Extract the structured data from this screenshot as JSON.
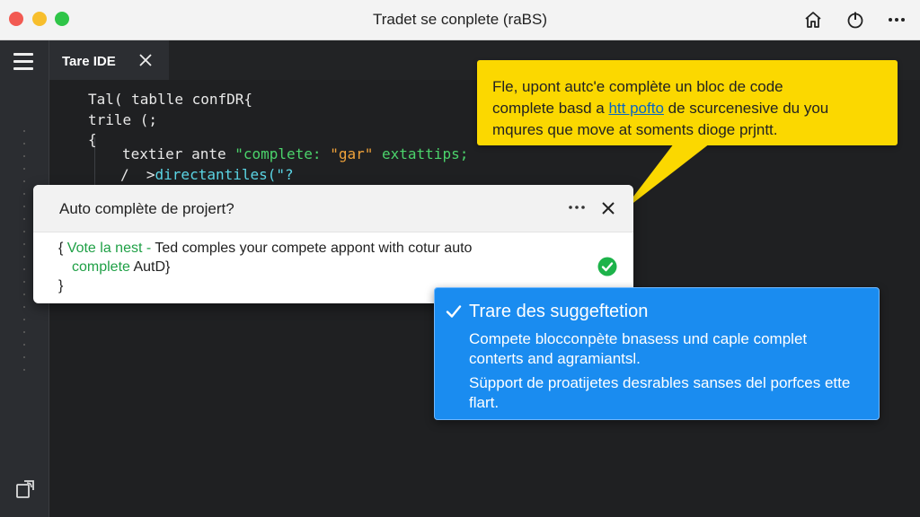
{
  "window": {
    "title": "Tradet se conplete (raBS)"
  },
  "titlebar_icons": [
    "home-icon",
    "power-icon",
    "more-icon"
  ],
  "tab": {
    "label": "Tare IDE"
  },
  "code": {
    "line1": "Tal( tablle confDR{",
    "line2": "trile (;",
    "line3": "{",
    "line4_a": "textier ante ",
    "line4_b": "\"complete: ",
    "line4_c": "\"gar\"",
    "line4_d": " extattips;",
    "line5_a": "/  >",
    "line5_b": "directantiles(\"?"
  },
  "callout": {
    "line1": "Fle, upont  autc'e complète un bloc de code",
    "line2_a": "complete basd a ",
    "line2_link": "htt pofto",
    "line2_b": " de scurcenesive du you",
    "line3": "mqures que move at soments dioge prjntt."
  },
  "dialog": {
    "title": "Auto complète de projert?",
    "line1_a": "{ ",
    "line1_b": "Vote la nest - ",
    "line1_c": "Ted comples your compete appont with cotur auto",
    "line2_a": "complete ",
    "line2_b": "AutD}",
    "line3": "}"
  },
  "suggestion": {
    "title": "Trare des suggeftetion",
    "p1": "Compete blocconpète bnasess und caple complet conterts and agramiantsl.",
    "p2": "Süpport de proatijetes desrables sanses del porfces ette flart."
  },
  "colors": {
    "accent_blue": "#1a8cf0",
    "callout_yellow": "#fbd800",
    "code_green": "#4bd36b",
    "success_green": "#1db34a"
  }
}
